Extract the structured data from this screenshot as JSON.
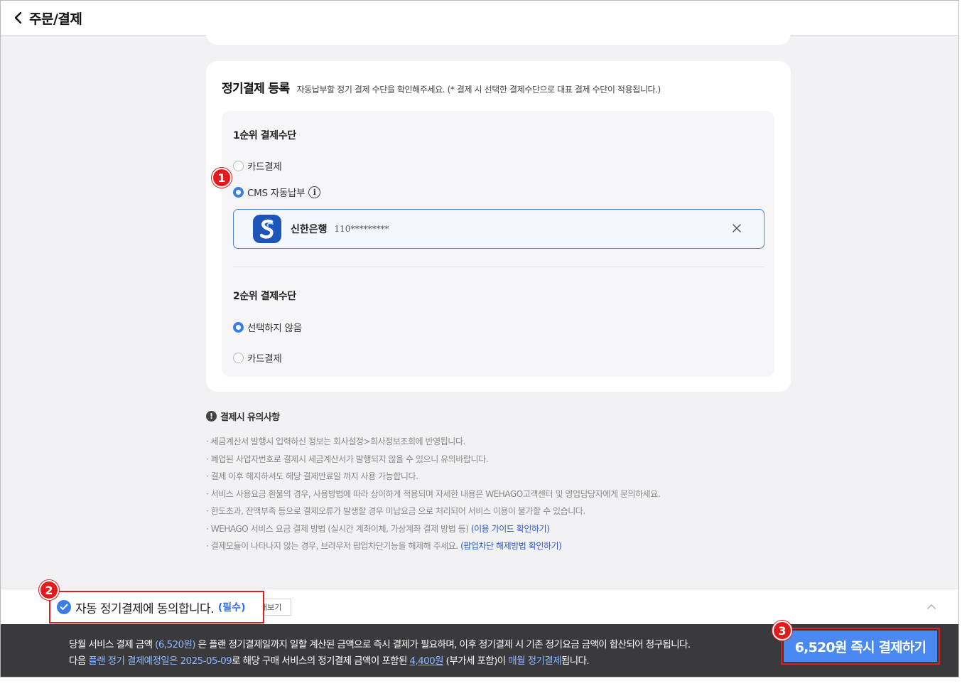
{
  "header": {
    "title": "주문/결제"
  },
  "registration": {
    "title": "정기결제 등록",
    "desc": "자동납부할 정기 결제 수단을 확인해주세요. (* 결제 시 선택한 결제수단으로 대표 결제 수단이 적용됩니다.)",
    "primary": {
      "title": "1순위 결제수단",
      "options": [
        {
          "label": "카드결제",
          "selected": false
        },
        {
          "label": "CMS 자동납부",
          "selected": true
        }
      ],
      "bank": {
        "name": "신한은행",
        "account": "110*********"
      }
    },
    "secondary": {
      "title": "2순위 결제수단",
      "options": [
        {
          "label": "선택하지 않음",
          "selected": true
        },
        {
          "label": "카드결제",
          "selected": false
        }
      ]
    }
  },
  "notice": {
    "title": "결제시 유의사항",
    "items": [
      "· 세금계산서 발행시 입력하신 정보는 회사설정>회사정보조회에 반영됩니다.",
      "· 폐업된 사업자번호로 결제시 세금계산서가 발행되지 않을 수 있으니 유의바랍니다.",
      "· 결제 이후 해지하셔도 해당 결제만료일 까지 사용 가능합니다.",
      "· 서비스 사용요금 환불의 경우, 사용방법에 따라 상이하게 적용되며 자세한 내용은 WEHAGO고객센터 및 영업담당자에게 문의하세요.",
      "· 한도초과, 잔액부족 등으로 결제오류가 발생할 경우 미납요금 으로 처리되어 서비스 이용이 불가할 수 있습니다."
    ],
    "item6_text": "· WEHAGO 서비스 요금 결제 방법 (실시간 계좌이체, 가상계좌 결제 방법 등) ",
    "item6_link": "(이용 가이드 확인하기)",
    "item7_text": "· 결제모듈이 나타나지 않는 경우, 브라우저 팝업차단기능을 해제해 주세요. ",
    "item7_link": "(팝업차단 해제방법 확인하기)"
  },
  "agree": {
    "text": "자동 정기결제에 동의합니다.",
    "required": "(필수)",
    "view_label": "내보기"
  },
  "payment": {
    "line1_a": "당월 서비스 결제 금액 ",
    "line1_amount": "(6,520원)",
    "line1_b": " 은 플랜 정기결제일까지 일할 계산된 금액으로 즉시 결제가 필요하며, 이후 정기결제 시 기존 정기요금 금액이 합산되어 청구됩니다.",
    "line2_a": "다음 ",
    "line2_date": "플랜 정기 결제예정일은 2025-05-09",
    "line2_b": "로 해당 구매 서비스의 정기결제 금액이 포함된 ",
    "line2_amount": "4,400원",
    "line2_c": " (부가세 포함)이 ",
    "line2_monthly": "매월 정기결제",
    "line2_d": "됩니다.",
    "button": "6,520원 즉시 결제하기"
  },
  "markers": [
    "1",
    "2",
    "3"
  ],
  "colors": {
    "accent": "#3a7fe8",
    "highlight": "#dc1f1f",
    "bank": "#1d56b8",
    "dark_bar": "#3a3a3d"
  }
}
